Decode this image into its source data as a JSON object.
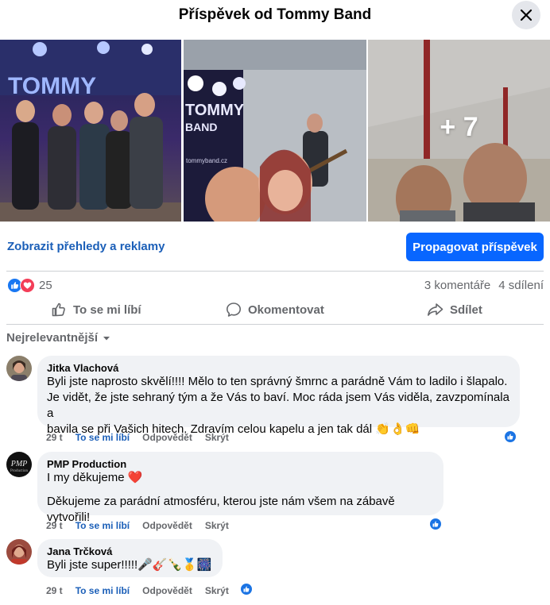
{
  "header": {
    "title": "Příspěvek od Tommy Band"
  },
  "photos": {
    "more_count": "+ 7",
    "band_banner": "TOMMY",
    "band_banner_sub": "BAND",
    "band_site": "tommyband.cz"
  },
  "post": {
    "insights_link": "Zobrazit přehledy a reklamy",
    "promote_button": "Propagovat příspěvek",
    "reactions_count": "25",
    "comments_count": "3 komentáře",
    "shares_count": "4 sdílení"
  },
  "actions": {
    "like": "To se mi líbí",
    "comment": "Okomentovat",
    "share": "Sdílet"
  },
  "sort_label": "Nejrelevantnější",
  "comments": [
    {
      "author": "Jitka Vlachová",
      "lines": [
        "Byli jste naprosto skvělí!!!! Mělo to ten správný šmrnc a parádně Vám to ladilo i šlapalo.",
        "Je vidět, že jste sehraný tým a že Vás to baví. Moc ráda jsem Vás viděla, zavzpomínala a",
        "bavila se při Vašich hitech. Zdravím celou kapelu a jen tak dál 👏👌👊"
      ],
      "time": "29 t",
      "like": "To se mi líbí",
      "reply": "Odpovědět",
      "hide": "Skrýt"
    },
    {
      "author": "PMP Production",
      "lines": [
        "I my děkujeme ❤️",
        "Děkujeme za parádní atmosféru, kterou jste nám všem na zábavě vytvořili!"
      ],
      "time": "29 t",
      "like": "To se mi líbí",
      "reply": "Odpovědět",
      "hide": "Skrýt"
    },
    {
      "author": "Jana Trčková",
      "lines": [
        "Byli jste super!!!!!🎤🎸🍾🥇🎆"
      ],
      "time": "29 t",
      "like": "To se mi líbí",
      "reply": "Odpovědět",
      "hide": "Skrýt"
    }
  ],
  "colors": {
    "accent": "#0866ff",
    "link": "#1b5fb8",
    "love": "#f33e58",
    "bubble": "#f0f2f5"
  }
}
